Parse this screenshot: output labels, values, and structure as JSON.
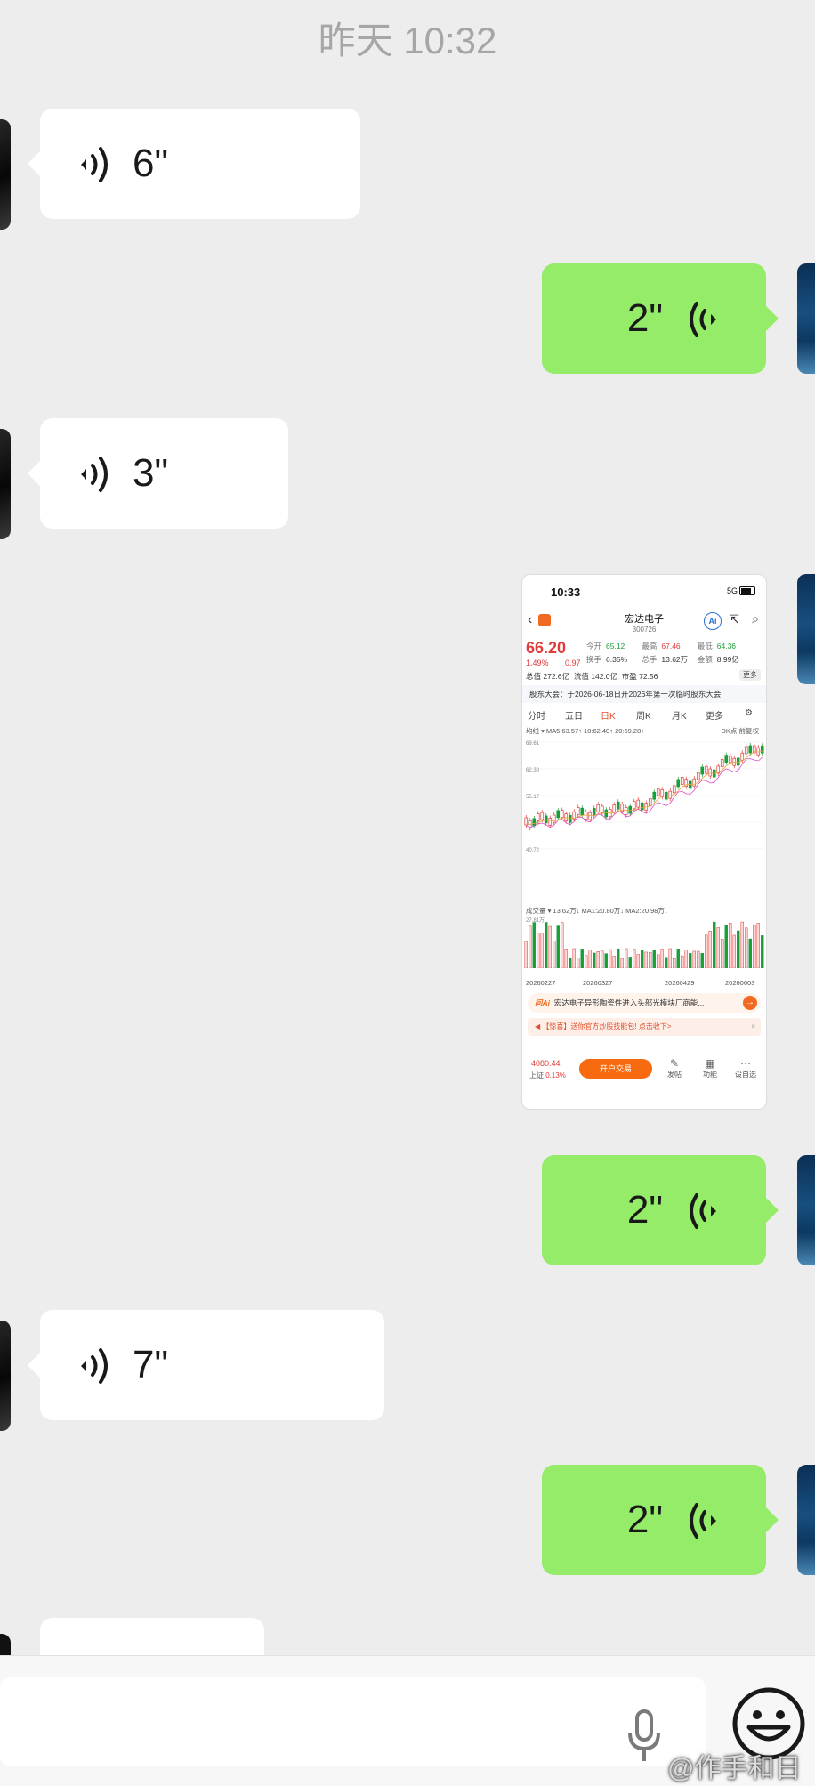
{
  "timestamp": "昨天 10:32",
  "messages": [
    {
      "side": "in",
      "type": "voice",
      "duration": "6\""
    },
    {
      "side": "out",
      "type": "voice",
      "duration": "2\""
    },
    {
      "side": "in",
      "type": "voice",
      "duration": "3\""
    },
    {
      "side": "out",
      "type": "image"
    },
    {
      "side": "out",
      "type": "voice",
      "duration": "2\""
    },
    {
      "side": "in",
      "type": "voice",
      "duration": "7\""
    },
    {
      "side": "out",
      "type": "voice",
      "duration": "2\""
    }
  ],
  "screenshot": {
    "status_time": "10:33",
    "network": "5G",
    "stock_name": "宏达电子",
    "stock_code": "300726",
    "ai_label": "Ai",
    "price": "66.20",
    "change_pct": "1.49%",
    "change_amt": "0.97",
    "stats": {
      "open_label": "今开",
      "open": "65.12",
      "high_label": "最高",
      "high": "67.46",
      "low_label": "最低",
      "low": "64.36",
      "turnover_label": "换手",
      "turnover": "6.35%",
      "volume_label": "总手",
      "volume": "13.62万",
      "amount_label": "金额",
      "amount": "8.99亿",
      "total_cap": "总值 272.6亿",
      "float_cap": "流值 142.0亿",
      "pe": "市盈 72.56"
    },
    "more_label": "更多",
    "notice": "股东大会：于2026-06-18日开2026年第一次临时股东大会",
    "tabs": [
      "分时",
      "五日",
      "日K",
      "周K",
      "月K",
      "更多"
    ],
    "ma_legend": "均线 ▾  MA5:63.57↑  10:62.40↑  20:59.28↑",
    "ma_right": "DK点  前复权",
    "price_ticks": [
      "69.61",
      "62.39",
      "55.17",
      "47.95",
      "40.72"
    ],
    "vol_legend": "成交量 ▾  13.62万↓  MA1:20.80万↓  MA2:20.98万↓",
    "vol_max": "27.81万",
    "dates": [
      "20260227",
      "20260327",
      "20260429",
      "20260603"
    ],
    "ask_brand": "问Ai",
    "ask_text": "宏达电子异形陶瓷件进入头部光模块厂商能...",
    "promo": "【惊喜】送你官方炒股技能包! 点击收下>",
    "index_value": "4080.44",
    "index_name": "上证",
    "index_change": "0.13%",
    "open_account": "开户交易",
    "bottom_buttons": [
      "发帖",
      "功能",
      "设自选"
    ]
  },
  "input": {
    "placeholder": ""
  },
  "watermark": "@作手和日",
  "icons": [
    "voice-wave-icon",
    "microphone-icon",
    "emoji-icon"
  ]
}
